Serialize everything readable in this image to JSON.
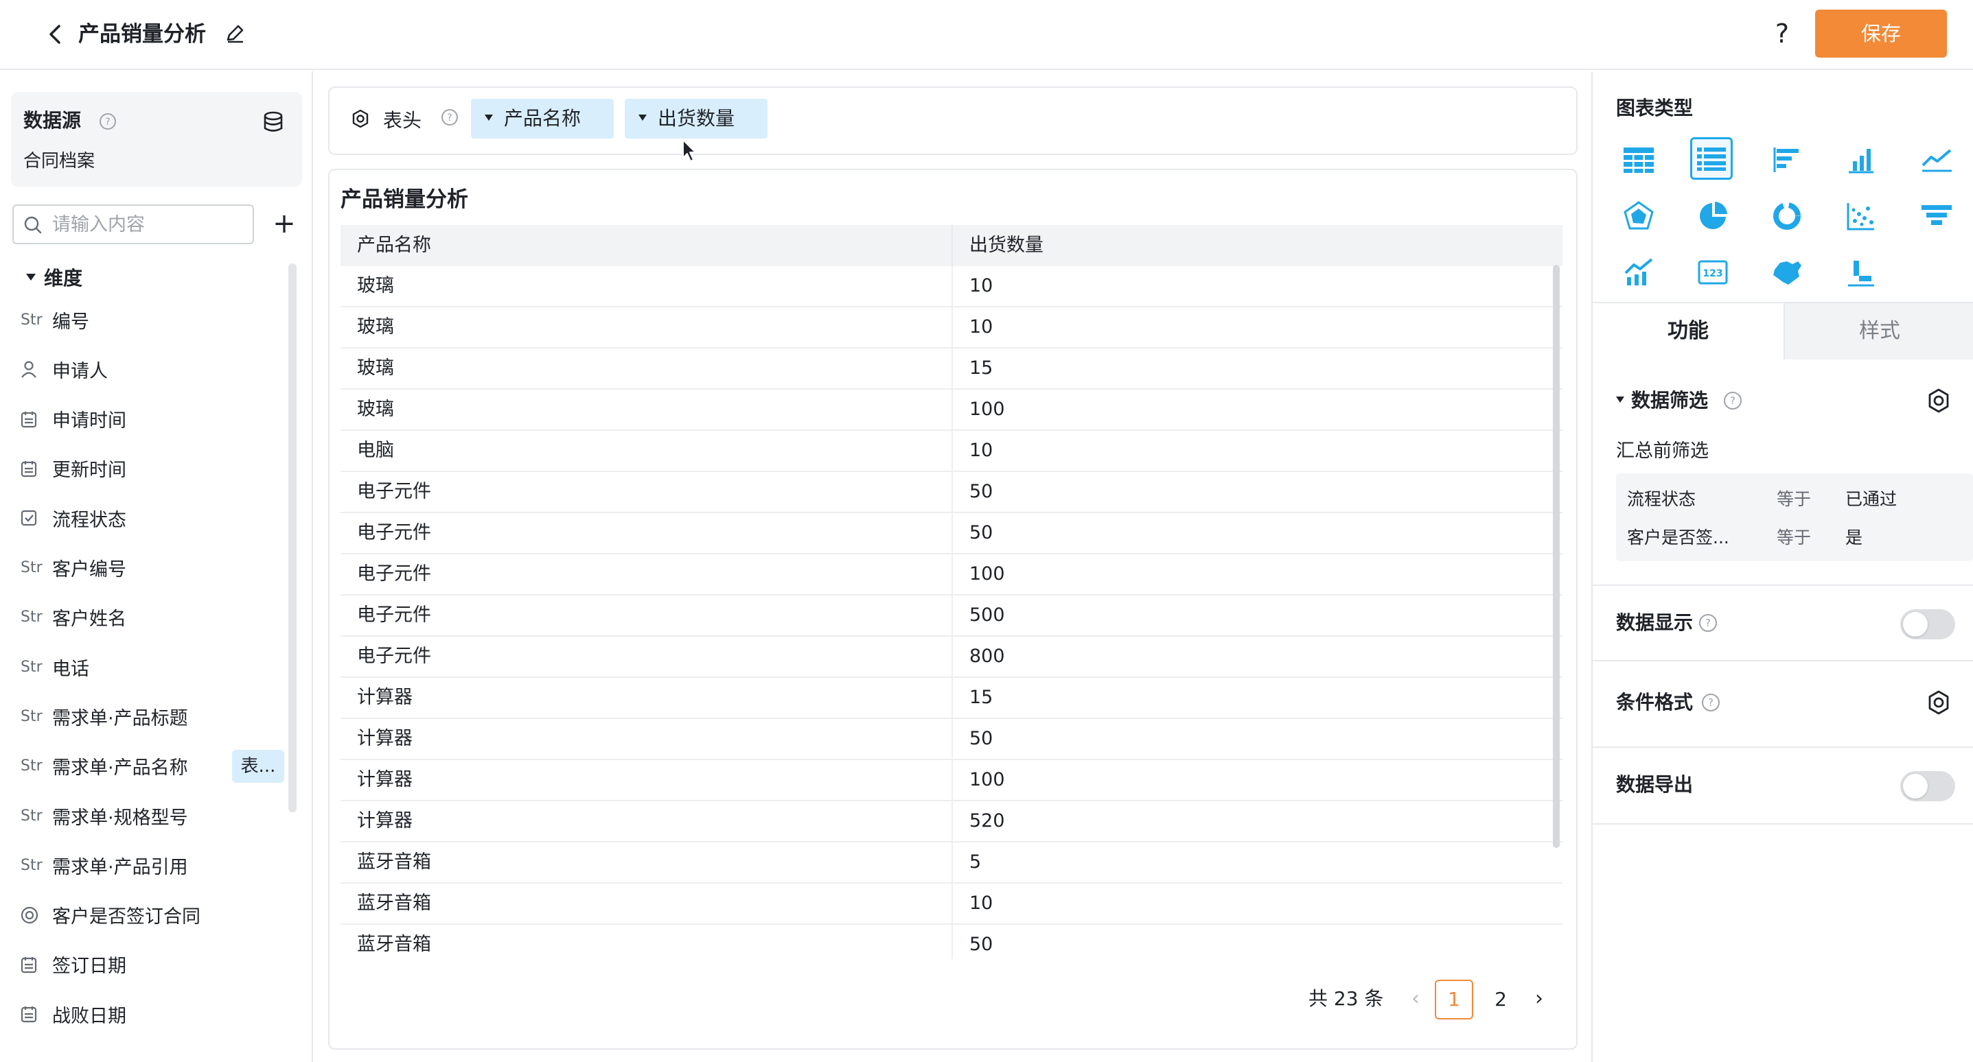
{
  "app": {
    "title": "产品销量分析",
    "save_label": "保存",
    "help_label": "?"
  },
  "datasource": {
    "title": "数据源",
    "name": "合同档案",
    "search_placeholder": "请输入内容",
    "add_label": "+"
  },
  "dimensions": {
    "title": "维度",
    "items": [
      {
        "type": "Str",
        "icon": "string-type-icon",
        "label": "编号",
        "tag": ""
      },
      {
        "type": "",
        "icon": "user-icon",
        "label": "申请人",
        "tag": ""
      },
      {
        "type": "",
        "icon": "calendar-icon",
        "label": "申请时间",
        "tag": ""
      },
      {
        "type": "",
        "icon": "calendar-icon",
        "label": "更新时间",
        "tag": ""
      },
      {
        "type": "",
        "icon": "checkbox-icon",
        "label": "流程状态",
        "tag": ""
      },
      {
        "type": "Str",
        "icon": "string-type-icon",
        "label": "客户编号",
        "tag": ""
      },
      {
        "type": "Str",
        "icon": "string-type-icon",
        "label": "客户姓名",
        "tag": ""
      },
      {
        "type": "Str",
        "icon": "string-type-icon",
        "label": "电话",
        "tag": ""
      },
      {
        "type": "Str",
        "icon": "string-type-icon",
        "label": "需求单·产品标题",
        "tag": ""
      },
      {
        "type": "Str",
        "icon": "string-type-icon",
        "label": "需求单·产品名称",
        "tag": "表..."
      },
      {
        "type": "Str",
        "icon": "string-type-icon",
        "label": "需求单·规格型号",
        "tag": ""
      },
      {
        "type": "Str",
        "icon": "string-type-icon",
        "label": "需求单·产品引用",
        "tag": ""
      },
      {
        "type": "",
        "icon": "radio-icon",
        "label": "客户是否签订合同",
        "tag": ""
      },
      {
        "type": "",
        "icon": "calendar-icon",
        "label": "签订日期",
        "tag": ""
      },
      {
        "type": "",
        "icon": "calendar-icon",
        "label": "战败日期",
        "tag": ""
      }
    ]
  },
  "header_bar": {
    "label": "表头",
    "chips": [
      "产品名称",
      "出货数量"
    ]
  },
  "table": {
    "title": "产品销量分析",
    "columns": [
      "产品名称",
      "出货数量"
    ],
    "rows": [
      [
        "玻璃",
        "10"
      ],
      [
        "玻璃",
        "10"
      ],
      [
        "玻璃",
        "15"
      ],
      [
        "玻璃",
        "100"
      ],
      [
        "电脑",
        "10"
      ],
      [
        "电子元件",
        "50"
      ],
      [
        "电子元件",
        "50"
      ],
      [
        "电子元件",
        "100"
      ],
      [
        "电子元件",
        "500"
      ],
      [
        "电子元件",
        "800"
      ],
      [
        "计算器",
        "15"
      ],
      [
        "计算器",
        "50"
      ],
      [
        "计算器",
        "100"
      ],
      [
        "计算器",
        "520"
      ],
      [
        "蓝牙音箱",
        "5"
      ],
      [
        "蓝牙音箱",
        "10"
      ],
      [
        "蓝牙音箱",
        "50"
      ]
    ]
  },
  "pagination": {
    "total": "共 23 条",
    "pages": [
      "1",
      "2"
    ],
    "current": "1",
    "prev": "‹",
    "next": "›"
  },
  "right_panel": {
    "chart_type_title": "图表类型",
    "chart_types": [
      "table-grid-icon",
      "list-table-icon",
      "horizontal-bar-icon",
      "vertical-bar-icon",
      "line-chart-icon",
      "radar-chart-icon",
      "pie-chart-icon",
      "donut-chart-icon",
      "scatter-chart-icon",
      "funnel-chart-icon",
      "combo-chart-icon",
      "number-card-icon",
      "map-chart-icon",
      "waterfall-chart-icon"
    ],
    "selected_chart_type": "list-table-icon",
    "tabs": [
      "功能",
      "样式"
    ],
    "active_tab": "功能",
    "data_filter": {
      "title": "数据筛选",
      "sub": "汇总前筛选",
      "rows": [
        {
          "field": "流程状态",
          "op": "等于",
          "value": "已通过"
        },
        {
          "field": "客户是否签...",
          "op": "等于",
          "value": "是"
        }
      ]
    },
    "data_display": {
      "title": "数据显示",
      "enabled": false
    },
    "conditional_format": {
      "title": "条件格式"
    },
    "data_export": {
      "title": "数据导出",
      "enabled": false
    }
  },
  "colors": {
    "accent": "#f28a37",
    "chip_bg": "#d9eefc",
    "selected_border": "#1fa7e8",
    "chart_icon": "#1fa7e8"
  }
}
